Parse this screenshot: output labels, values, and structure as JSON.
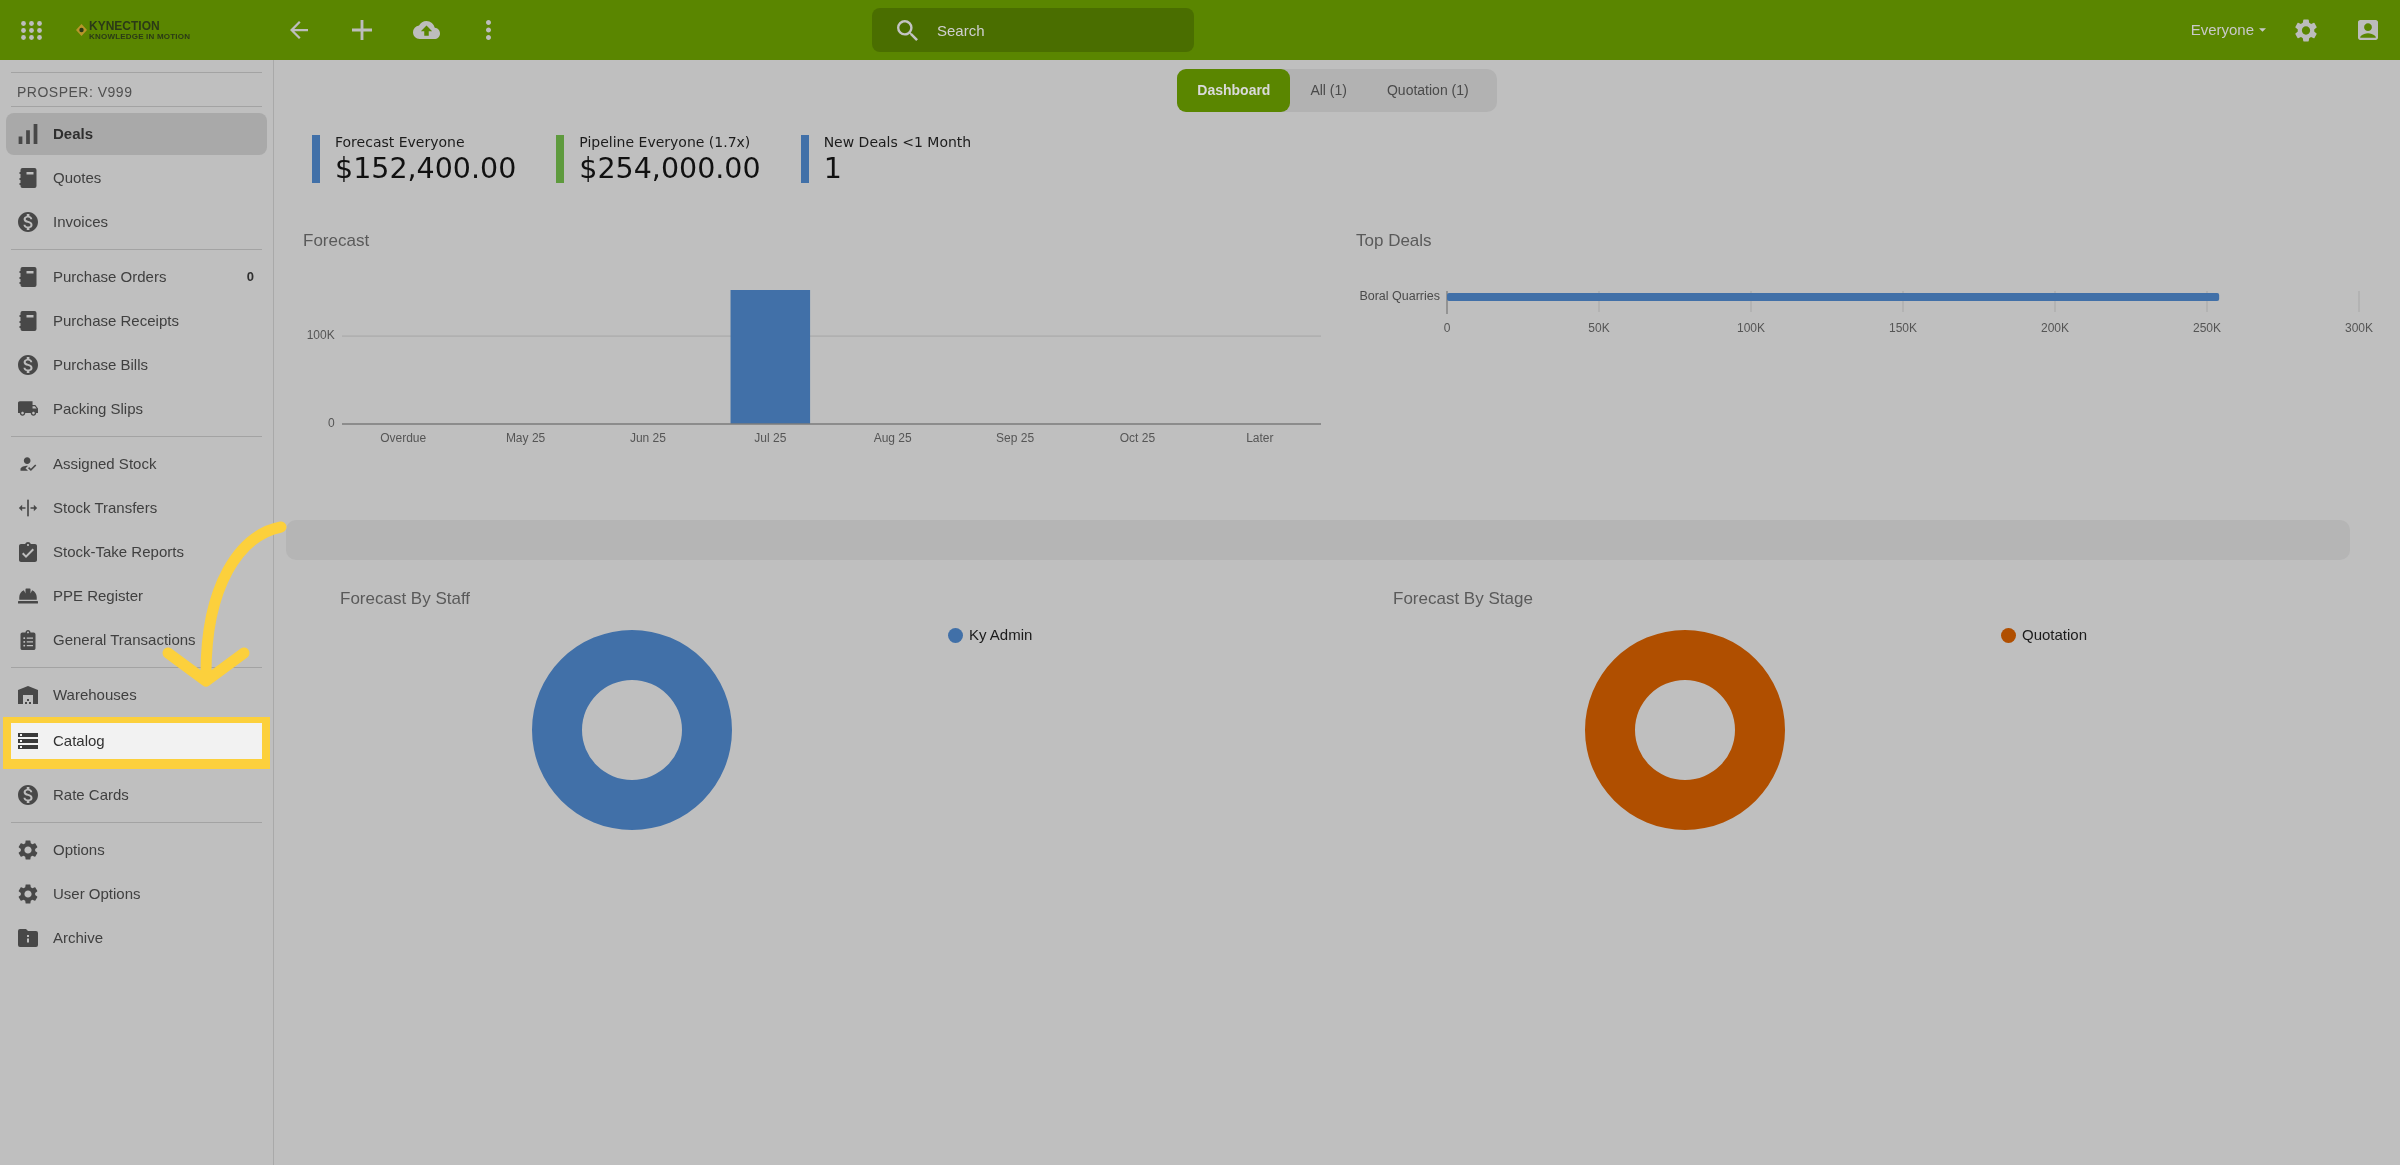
{
  "top_bar": {
    "logo": {
      "name": "KYNECTION",
      "tagline": "KNOWLEDGE IN MOTION"
    },
    "search": {
      "placeholder": "Search"
    },
    "scope_menu": {
      "label": "Everyone"
    }
  },
  "sidebar": {
    "header": "PROSPER: V999",
    "groups": [
      {
        "items": [
          {
            "label": "Deals",
            "selected": true,
            "highlighted": false
          },
          {
            "label": "Quotes",
            "selected": false,
            "highlighted": false
          },
          {
            "label": "Invoices",
            "selected": false,
            "highlighted": false
          }
        ]
      },
      {
        "items": [
          {
            "label": "Purchase Orders",
            "badge": "0",
            "selected": false,
            "highlighted": false
          },
          {
            "label": "Purchase Receipts",
            "selected": false,
            "highlighted": false
          },
          {
            "label": "Purchase Bills",
            "selected": false,
            "highlighted": false
          },
          {
            "label": "Packing Slips",
            "selected": false,
            "highlighted": false
          }
        ]
      },
      {
        "items": [
          {
            "label": "Assigned Stock",
            "selected": false,
            "highlighted": false
          },
          {
            "label": "Stock Transfers",
            "selected": false,
            "highlighted": false
          },
          {
            "label": "Stock-Take Reports",
            "selected": false,
            "highlighted": false
          },
          {
            "label": "PPE Register",
            "selected": false,
            "highlighted": false
          },
          {
            "label": "General Transactions",
            "selected": false,
            "highlighted": false
          }
        ]
      },
      {
        "items": [
          {
            "label": "Warehouses",
            "selected": false,
            "highlighted": false
          },
          {
            "label": "Catalog",
            "selected": false,
            "highlighted": true
          },
          {
            "label": "Rate Cards",
            "selected": false,
            "highlighted": false
          }
        ]
      },
      {
        "items": [
          {
            "label": "Options",
            "selected": false,
            "highlighted": false
          },
          {
            "label": "User Options",
            "selected": false,
            "highlighted": false
          },
          {
            "label": "Archive",
            "selected": false,
            "highlighted": false
          }
        ]
      }
    ]
  },
  "tabs": [
    {
      "label": "Dashboard",
      "selected": true
    },
    {
      "label": "All (1)",
      "selected": false
    },
    {
      "label": "Quotation (1)",
      "selected": false
    }
  ],
  "kpis": [
    {
      "label": "Forecast Everyone",
      "value": "$152,400.00",
      "color": "#4170a8"
    },
    {
      "label": "Pipeline Everyone (1.7x)",
      "value": "$254,000.00",
      "color": "#5e9a3d"
    },
    {
      "label": "New Deals <1 Month",
      "value": "1",
      "color": "#4170a8"
    }
  ],
  "forecast": {
    "chart_data": {
      "type": "bar",
      "title": "Forecast",
      "categories": [
        "Overdue",
        "May 25",
        "Jun 25",
        "Jul 25",
        "Aug 25",
        "Sep 25",
        "Oct 25",
        "Later"
      ],
      "series": [
        {
          "color": "#4170a8",
          "values": [
            0,
            0,
            0,
            152400,
            0,
            0,
            0,
            0
          ]
        }
      ],
      "ylim": [
        0,
        152400
      ],
      "yticks": [
        {
          "value": 0,
          "label": "0"
        },
        {
          "value": 100000,
          "label": "100K"
        }
      ],
      "ref_lines": [
        {
          "axis": "y",
          "value": 100000
        }
      ]
    }
  },
  "top_deals": {
    "chart_data": {
      "type": "bar",
      "orientation": "horizontal",
      "title": "Top Deals",
      "categories": [
        "Boral Quarries"
      ],
      "series": [
        {
          "color": "#4170a8",
          "values": [
            254000
          ]
        }
      ],
      "xlim": [
        0,
        300000
      ],
      "xticks": [
        {
          "value": 0,
          "label": "0"
        },
        {
          "value": 50000,
          "label": "50K"
        },
        {
          "value": 100000,
          "label": "100K"
        },
        {
          "value": 150000,
          "label": "150K"
        },
        {
          "value": 200000,
          "label": "200K"
        },
        {
          "value": 250000,
          "label": "250K"
        },
        {
          "value": 300000,
          "label": "300K"
        }
      ]
    }
  },
  "forecast_by_staff": {
    "title": "Forecast By Staff",
    "legend": [
      {
        "label": "Ky Admin",
        "color": "#4170a8"
      }
    ]
  },
  "forecast_by_stage": {
    "title": "Forecast By Stage",
    "legend": [
      {
        "label": "Quotation",
        "color": "#b04f00"
      }
    ]
  }
}
